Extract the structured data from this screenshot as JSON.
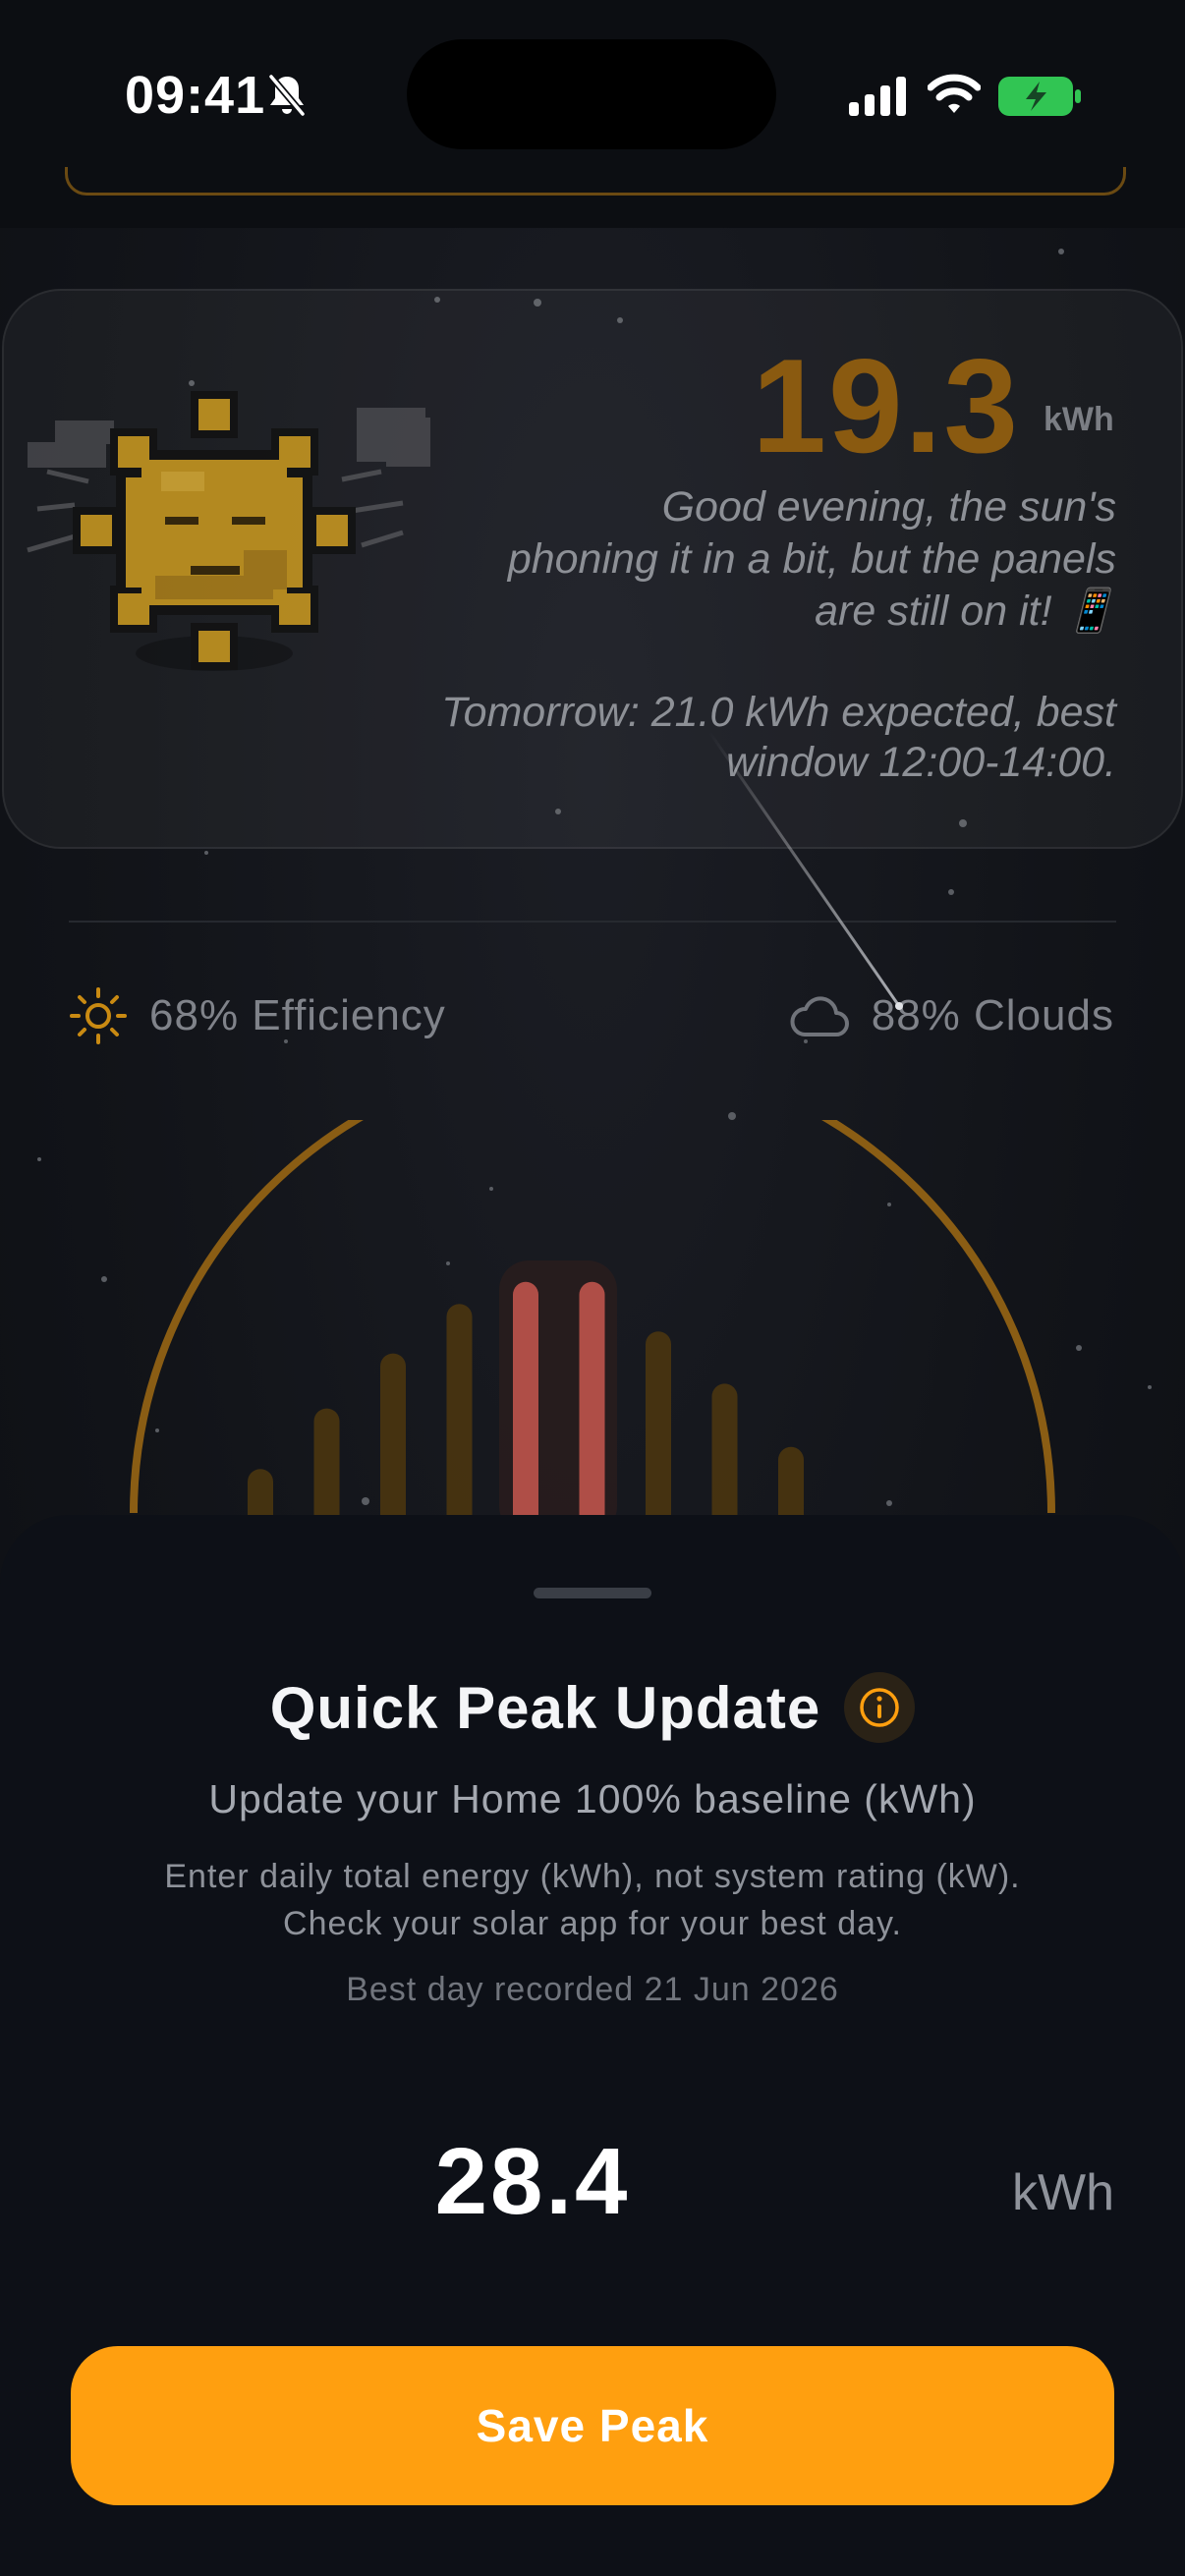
{
  "status_bar": {
    "time": "09:41"
  },
  "hero": {
    "energy_value": "19.3",
    "energy_unit": "kWh",
    "greeting": "Good evening, the sun's phoning it in a bit, but the panels are still on it! 📱",
    "forecast": "Tomorrow: 21.0 kWh expected, best window 12:00-14:00."
  },
  "stats": {
    "efficiency_label": "68% Efficiency",
    "clouds_label": "88% Clouds"
  },
  "gauge": {
    "bar_levels": [
      0.16,
      0.38,
      0.58,
      0.76,
      0.84,
      0.84,
      0.66,
      0.47,
      0.24
    ]
  },
  "sheet": {
    "title": "Quick Peak Update",
    "subtitle": "Update your Home 100% baseline (kWh)",
    "help_line_1": "Enter daily total energy (kWh), not system rating (kW).",
    "help_line_2": "Check your solar app for your best day.",
    "best_day": "Best day recorded 21 Jun 2026",
    "peak_value": "28.4",
    "peak_unit": "kWh",
    "save_label": "Save Peak"
  },
  "colors": {
    "accent": "#ff9f0f",
    "sun": "#d9a420",
    "peak_bar": "#c8574f",
    "battery": "#31c553"
  }
}
